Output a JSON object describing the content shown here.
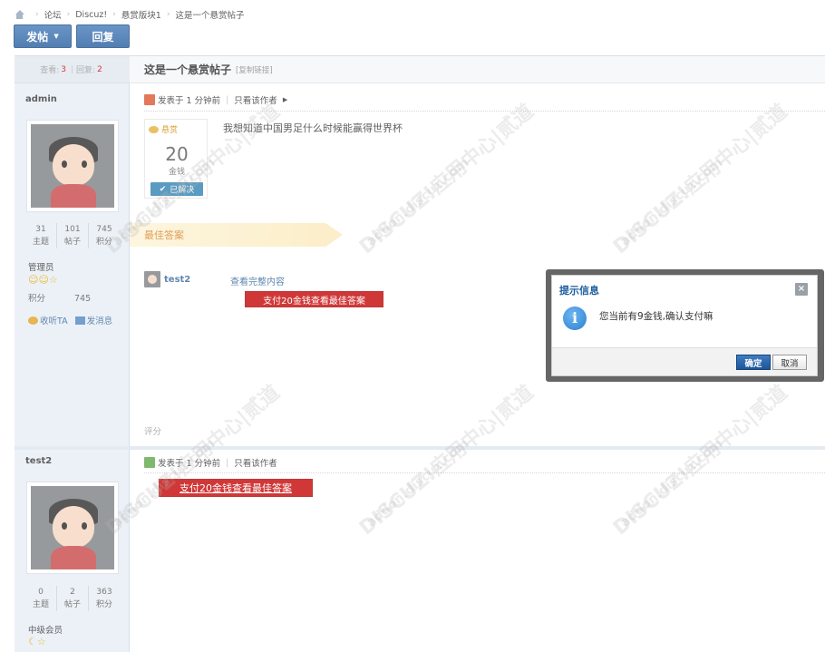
{
  "breadcrumb": {
    "items": [
      "论坛",
      "Discuz!",
      "悬赏版块1",
      "这是一个悬赏帖子"
    ]
  },
  "toolbar": {
    "post_label": "发帖",
    "reply_label": "回复"
  },
  "thread": {
    "views_label": "查看:",
    "views": "3",
    "replies_label": "回复:",
    "replies": "2",
    "title": "这是一个悬赏帖子",
    "copy_link": "[复制链接]"
  },
  "post1": {
    "author": "admin",
    "stats": [
      {
        "value": "31",
        "label": "主题"
      },
      {
        "value": "101",
        "label": "帖子"
      },
      {
        "value": "745",
        "label": "积分"
      }
    ],
    "group": "管理员",
    "stars": "☺☺☆",
    "score_label": "积分",
    "score_value": "745",
    "follow": "收听TA",
    "message": "发消息",
    "posted": "发表于 1 分钟前",
    "only_author": "只看该作者",
    "reward_label": "悬赏",
    "reward_amount": "20",
    "reward_unit": "金钱",
    "solved": "已解决",
    "question": "我想知道中国男足什么时候能赢得世界杯",
    "best_answer": "最佳答案",
    "best_user": "test2",
    "view_full": "查看完整内容",
    "pay_button": "支付20金钱查看最佳答案",
    "rate": "评分"
  },
  "post2": {
    "author": "test2",
    "stats": [
      {
        "value": "0",
        "label": "主题"
      },
      {
        "value": "2",
        "label": "帖子"
      },
      {
        "value": "363",
        "label": "积分"
      }
    ],
    "group": "中级会员",
    "stars": "☾☆",
    "posted": "发表于 1 分钟前",
    "only_author": "只看该作者",
    "pay_button": "支付20金钱查看最佳答案"
  },
  "watermark": "DISCUZ!应用中心|贰道",
  "watermark_url": "addon.discuz.com",
  "dialog": {
    "title": "提示信息",
    "close": "×",
    "icon": "i",
    "message": "您当前有9金钱,确认支付嘛",
    "ok": "确定",
    "cancel": "取消"
  },
  "colors": {
    "accent": "#225a9b",
    "pay_red": "#c30000",
    "best_orange": "#d6862a"
  }
}
